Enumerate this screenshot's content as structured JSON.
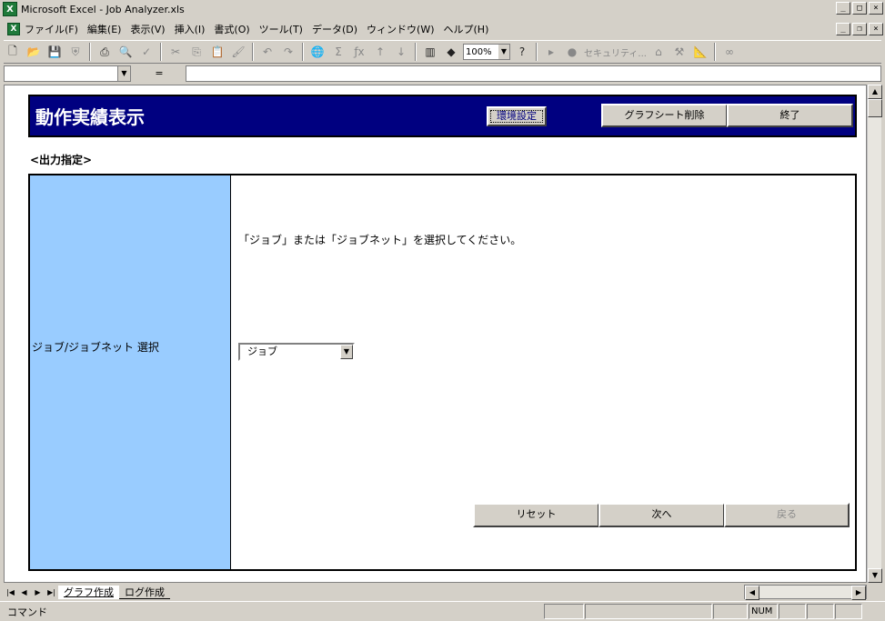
{
  "window": {
    "title": "Microsoft Excel - Job Analyzer.xls"
  },
  "menubar": {
    "items": [
      "ファイル(F)",
      "編集(E)",
      "表示(V)",
      "挿入(I)",
      "書式(O)",
      "ツール(T)",
      "データ(D)",
      "ウィンドウ(W)",
      "ヘルプ(H)"
    ]
  },
  "toolbar": {
    "zoom": "100%",
    "security_label": "セキュリティ..."
  },
  "formula_bar": {
    "equals": "="
  },
  "header": {
    "title": "動作実績表示",
    "env_button": "環境設定",
    "delete_graph_button": "グラフシート削除",
    "exit_button": "終了"
  },
  "section": {
    "label": "<出力指定>"
  },
  "form": {
    "left_label": "ジョブ/ジョブネット 選択",
    "instruction": "「ジョブ」または「ジョブネット」を選択してください。",
    "select_value": "ジョブ"
  },
  "footer_buttons": {
    "reset": "リセット",
    "next": "次へ",
    "back": "戻る"
  },
  "sheet_tabs": [
    "グラフ作成",
    "ログ作成"
  ],
  "status": {
    "mode": "コマンド",
    "num": "NUM"
  },
  "colors": {
    "header_band": "#000080",
    "left_panel": "#99ccff"
  }
}
